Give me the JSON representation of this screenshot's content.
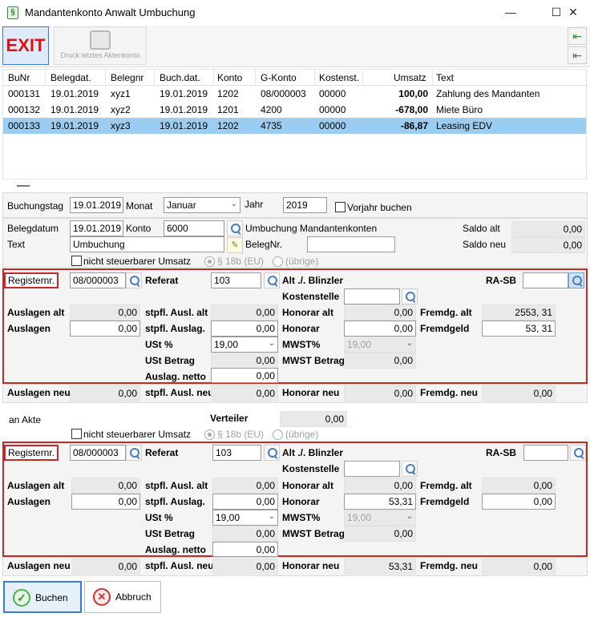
{
  "window": {
    "title": "Mandantenkonto Anwalt Umbuchung",
    "icon_glyph": "§",
    "minimize_glyph": "—",
    "maximize_glyph": "☐",
    "close_glyph": "✕"
  },
  "toolbar": {
    "exit_label": "EXIT",
    "print_label": "Druck letztes Aktenkonto"
  },
  "grid": {
    "headers": [
      "BuNr",
      "Belegdat.",
      "Belegnr",
      "Buch.dat.",
      "Konto",
      "G-Konto",
      "Kostenst.",
      "Umsatz",
      "Text"
    ],
    "rows": [
      {
        "bunr": "000131",
        "belegdat": "19.01.2019",
        "belegnr": "xyz1",
        "buchdat": "19.01.2019",
        "konto": "1202",
        "gkonto": "08/000003",
        "kostenst": "00000",
        "umsatz": "100,00",
        "text": "Zahlung des Mandanten",
        "selected": false
      },
      {
        "bunr": "000132",
        "belegdat": "19.01.2019",
        "belegnr": "xyz2",
        "buchdat": "19.01.2019",
        "konto": "1201",
        "gkonto": "4200",
        "kostenst": "00000",
        "umsatz": "-678,00",
        "text": "Miete Büro",
        "selected": false
      },
      {
        "bunr": "000133",
        "belegdat": "19.01.2019",
        "belegnr": "xyz3",
        "buchdat": "19.01.2019",
        "konto": "1202",
        "gkonto": "4735",
        "kostenst": "00000",
        "umsatz": "-86,87",
        "text": "Leasing EDV",
        "selected": true
      }
    ]
  },
  "header": {
    "buchungstag_label": "Buchungstag",
    "buchungstag": "19.01.2019",
    "monat_label": "Monat",
    "monat": "Januar",
    "jahr_label": "Jahr",
    "jahr": "2019",
    "vorjahr_label": "Vorjahr buchen"
  },
  "beleg": {
    "belegdatum_label": "Belegdatum",
    "belegdatum": "19.01.2019",
    "konto_label": "Konto",
    "konto": "6000",
    "konto_name": "Umbuchung Mandantenkonten",
    "text_label": "Text",
    "text": "Umbuchung",
    "belegnr_label": "BelegNr.",
    "belegnr": "",
    "saldo_alt_label": "Saldo alt",
    "saldo_alt": "0,00",
    "saldo_neu_label": "Saldo neu",
    "saldo_neu": "0,00",
    "nicht_steuerbar_label": "nicht steuerbarer Umsatz",
    "radio_18b": "§ 18b (EU)",
    "radio_uebrige": "(übrige)"
  },
  "akte1": {
    "registernr_label": "Registernr.",
    "registernr": "08/000003",
    "referat_label": "Referat",
    "referat": "103",
    "anwalt": "Alt ./. Blinzler",
    "rasb_label": "RA-SB",
    "rasb": "",
    "kostenstelle_label": "Kostenstelle",
    "kostenstelle": "",
    "auslagen_alt_label": "Auslagen alt",
    "auslagen_alt": "0,00",
    "auslagen_label": "Auslagen",
    "auslagen": "0,00",
    "stpfl_alt_label": "stpfl. Ausl. alt",
    "stpfl_alt": "0,00",
    "stpfl_label": "stpfl. Auslag.",
    "stpfl": "0,00",
    "ust_label": "USt %",
    "ust": "19,00",
    "ust_betrag_label": "USt Betrag",
    "ust_betrag": "0,00",
    "netto_label": "Auslag. netto",
    "netto": "0,00",
    "honorar_alt_label": "Honorar alt",
    "honorar_alt": "0,00",
    "honorar_label": "Honorar",
    "honorar": "0,00",
    "mwst_label": "MWST%",
    "mwst": "19,00",
    "mwst_betrag_label": "MWST Betrag",
    "mwst_betrag": "0,00",
    "fremdg_alt_label": "Fremdg. alt",
    "fremdg_alt": "2553, 31",
    "fremdgeld_label": "Fremdgeld",
    "fremdgeld": "53, 31"
  },
  "neu1": {
    "auslagen_neu_label": "Auslagen neu",
    "auslagen_neu": "0,00",
    "stpfl_neu_label": "stpfl. Ausl. neu",
    "stpfl_neu": "0,00",
    "honorar_neu_label": "Honorar neu",
    "honorar_neu": "0,00",
    "fremdg_neu_label": "Fremdg. neu",
    "fremdg_neu": "0,00"
  },
  "verteiler": {
    "an_akte_label": "an Akte",
    "verteiler_label": "Verteiler",
    "verteiler": "0,00",
    "nicht_steuerbar_label": "nicht steuerbarer Umsatz",
    "radio_18b": "§ 18b (EU)",
    "radio_uebrige": "(übrige)"
  },
  "akte2": {
    "registernr_label": "Registernr.",
    "registernr": "08/000003",
    "referat_label": "Referat",
    "referat": "103",
    "anwalt": "Alt ./. Blinzler",
    "rasb_label": "RA-SB",
    "rasb": "",
    "kostenstelle_label": "Kostenstelle",
    "kostenstelle": "",
    "auslagen_alt_label": "Auslagen alt",
    "auslagen_alt": "0,00",
    "auslagen_label": "Auslagen",
    "auslagen": "0,00",
    "stpfl_alt_label": "stpfl. Ausl. alt",
    "stpfl_alt": "0,00",
    "stpfl_label": "stpfl. Auslag.",
    "stpfl": "0,00",
    "ust_label": "USt %",
    "ust": "19,00",
    "ust_betrag_label": "USt Betrag",
    "ust_betrag": "0,00",
    "netto_label": "Auslag. netto",
    "netto": "0,00",
    "honorar_alt_label": "Honorar alt",
    "honorar_alt": "0,00",
    "honorar_label": "Honorar",
    "honorar": "53,31",
    "mwst_label": "MWST%",
    "mwst": "19,00",
    "mwst_betrag_label": "MWST Betrag",
    "mwst_betrag": "0,00",
    "fremdg_alt_label": "Fremdg. alt",
    "fremdg_alt": "0,00",
    "fremdgeld_label": "Fremdgeld",
    "fremdgeld": "0,00"
  },
  "neu2": {
    "auslagen_neu_label": "Auslagen neu",
    "auslagen_neu": "0,00",
    "stpfl_neu_label": "stpfl. Ausl. neu",
    "stpfl_neu": "0,00",
    "honorar_neu_label": "Honorar neu",
    "honorar_neu": "53,31",
    "fremdg_neu_label": "Fremdg. neu",
    "fremdg_neu": "0,00"
  },
  "buttons": {
    "buchen": "Buchen",
    "abbruch": "Abbruch",
    "check_glyph": "✓",
    "cross_glyph": "✕",
    "nav_in_glyph": "⇤",
    "nav_out_glyph": "⇤"
  },
  "colors": {
    "selected_row": "#99cdf4",
    "highlight_border": "#c62828",
    "exit_text": "#dd1111"
  }
}
